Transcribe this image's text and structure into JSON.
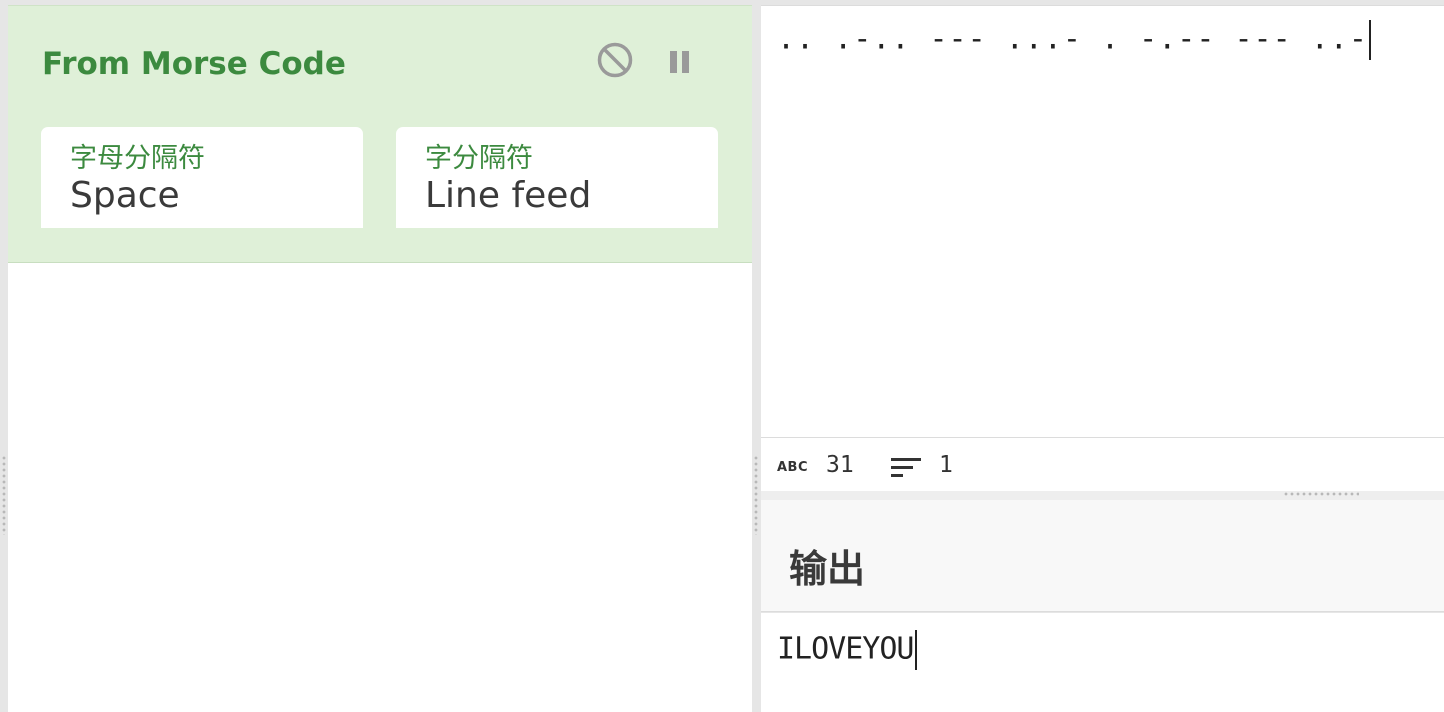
{
  "recipe": {
    "operation": {
      "title": "From Morse Code",
      "disable_icon": "disable-icon",
      "pause_icon": "pause-icon",
      "args": [
        {
          "label": "字母分隔符",
          "value": "Space"
        },
        {
          "label": "字分隔符",
          "value": "Line feed"
        }
      ]
    }
  },
  "input": {
    "text": ".. .-.. --- ...- . -.-- --- ..-"
  },
  "status": {
    "length_icon": "abc-icon",
    "length": "31",
    "lines_icon": "lines-icon",
    "lines": "1"
  },
  "output": {
    "title": "输出",
    "text": "ILOVEYOU"
  },
  "colors": {
    "operation_bg": "#dff0d8",
    "operation_text": "#3c8a3f"
  }
}
